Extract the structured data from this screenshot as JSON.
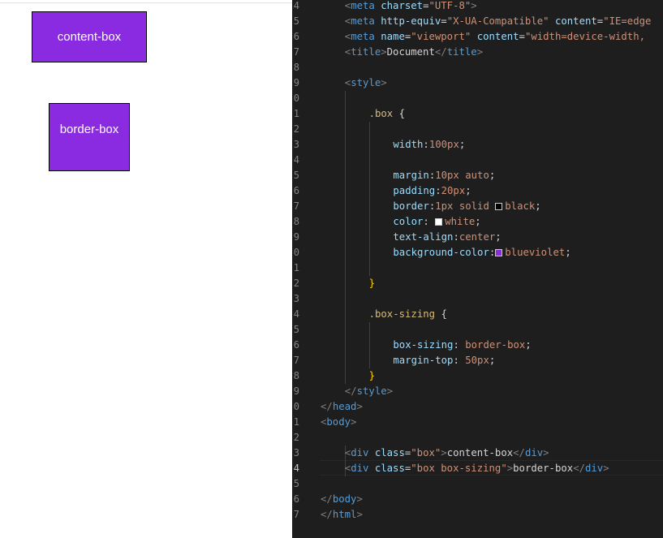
{
  "preview": {
    "boxes": [
      {
        "label": "content-box"
      },
      {
        "label": "border-box"
      }
    ],
    "box_bg": "#8a2be2"
  },
  "editor": {
    "active_line": "4",
    "lines": [
      {
        "num": "4",
        "tokens": [
          [
            "t-pun",
            "<"
          ],
          [
            "t-tag",
            "meta "
          ],
          [
            "t-attr",
            "charset"
          ],
          [
            "t-txt",
            "="
          ],
          [
            "t-str",
            "\"UTF-8\""
          ],
          [
            "t-pun",
            ">"
          ]
        ]
      },
      {
        "num": "5",
        "tokens": [
          [
            "t-pun",
            "<"
          ],
          [
            "t-tag",
            "meta "
          ],
          [
            "t-attr",
            "http-equiv"
          ],
          [
            "t-txt",
            "="
          ],
          [
            "t-str",
            "\"X-UA-Compatible\" "
          ],
          [
            "t-attr",
            "content"
          ],
          [
            "t-txt",
            "="
          ],
          [
            "t-str",
            "\"IE=edge"
          ]
        ]
      },
      {
        "num": "6",
        "tokens": [
          [
            "t-pun",
            "<"
          ],
          [
            "t-tag",
            "meta "
          ],
          [
            "t-attr",
            "name"
          ],
          [
            "t-txt",
            "="
          ],
          [
            "t-str",
            "\"viewport\" "
          ],
          [
            "t-attr",
            "content"
          ],
          [
            "t-txt",
            "="
          ],
          [
            "t-str",
            "\"width=device-width,"
          ]
        ]
      },
      {
        "num": "7",
        "tokens": [
          [
            "t-pun",
            "<"
          ],
          [
            "t-tag",
            "title"
          ],
          [
            "t-pun",
            ">"
          ],
          [
            "t-txt",
            "Document"
          ],
          [
            "t-pun",
            "</"
          ],
          [
            "t-tag",
            "title"
          ],
          [
            "t-pun",
            ">"
          ]
        ]
      },
      {
        "num": "8",
        "tokens": []
      },
      {
        "num": "9",
        "tokens": [
          [
            "t-pun",
            "<"
          ],
          [
            "t-tag",
            "style"
          ],
          [
            "t-pun",
            ">"
          ]
        ]
      },
      {
        "num": "0",
        "tokens": []
      },
      {
        "num": "1",
        "tokens": [
          [
            "t-sel",
            ".box "
          ],
          [
            "t-txt",
            "{"
          ]
        ]
      },
      {
        "num": "2",
        "tokens": []
      },
      {
        "num": "3",
        "tokens": [
          [
            "t-prop",
            "width"
          ],
          [
            "t-txt",
            ":"
          ],
          [
            "t-val",
            "100px"
          ],
          [
            "t-txt",
            ";"
          ]
        ]
      },
      {
        "num": "4",
        "tokens": []
      },
      {
        "num": "5",
        "tokens": [
          [
            "t-prop",
            "margin"
          ],
          [
            "t-txt",
            ":"
          ],
          [
            "t-val",
            "10px auto"
          ],
          [
            "t-txt",
            ";"
          ]
        ]
      },
      {
        "num": "6",
        "tokens": [
          [
            "t-prop",
            "padding"
          ],
          [
            "t-txt",
            ":"
          ],
          [
            "t-val",
            "20px"
          ],
          [
            "t-txt",
            ";"
          ]
        ]
      },
      {
        "num": "7",
        "tokens": [
          [
            "t-prop",
            "border"
          ],
          [
            "t-txt",
            ":"
          ],
          [
            "t-val",
            "1px solid "
          ],
          [
            "swatch",
            "#000000"
          ],
          [
            "t-val",
            "black"
          ],
          [
            "t-txt",
            ";"
          ]
        ]
      },
      {
        "num": "8",
        "tokens": [
          [
            "t-prop",
            "color"
          ],
          [
            "t-txt",
            ": "
          ],
          [
            "swatch",
            "#ffffff"
          ],
          [
            "t-val",
            "white"
          ],
          [
            "t-txt",
            ";"
          ]
        ]
      },
      {
        "num": "9",
        "tokens": [
          [
            "t-prop",
            "text-align"
          ],
          [
            "t-txt",
            ":"
          ],
          [
            "t-val",
            "center"
          ],
          [
            "t-txt",
            ";"
          ]
        ]
      },
      {
        "num": "0",
        "tokens": [
          [
            "t-prop",
            "background-color"
          ],
          [
            "t-txt",
            ":"
          ],
          [
            "swatch",
            "#8a2be2"
          ],
          [
            "t-val",
            "blueviolet"
          ],
          [
            "t-txt",
            ";"
          ]
        ]
      },
      {
        "num": "1",
        "tokens": []
      },
      {
        "num": "2",
        "tokens": [
          [
            "t-brace",
            "}"
          ]
        ]
      },
      {
        "num": "3",
        "tokens": []
      },
      {
        "num": "4",
        "tokens": [
          [
            "t-sel",
            ".box-sizing "
          ],
          [
            "t-txt",
            "{"
          ]
        ]
      },
      {
        "num": "5",
        "tokens": []
      },
      {
        "num": "6",
        "tokens": [
          [
            "t-prop",
            "box-sizing"
          ],
          [
            "t-txt",
            ": "
          ],
          [
            "t-val",
            "border-box"
          ],
          [
            "t-txt",
            ";"
          ]
        ]
      },
      {
        "num": "7",
        "tokens": [
          [
            "t-prop",
            "margin-top"
          ],
          [
            "t-txt",
            ": "
          ],
          [
            "t-val",
            "50px"
          ],
          [
            "t-txt",
            ";"
          ]
        ]
      },
      {
        "num": "8",
        "tokens": [
          [
            "t-brace",
            "}"
          ]
        ]
      },
      {
        "num": "9",
        "tokens": [
          [
            "t-pun",
            "</"
          ],
          [
            "t-tag",
            "style"
          ],
          [
            "t-pun",
            ">"
          ]
        ]
      },
      {
        "num": "0",
        "tokens": [
          [
            "t-pun",
            "</"
          ],
          [
            "t-tag",
            "head"
          ],
          [
            "t-pun",
            ">"
          ]
        ]
      },
      {
        "num": "1",
        "tokens": [
          [
            "t-pun",
            "<"
          ],
          [
            "t-tag",
            "body"
          ],
          [
            "t-pun",
            ">"
          ]
        ]
      },
      {
        "num": "2",
        "tokens": []
      },
      {
        "num": "3",
        "tokens": [
          [
            "t-pun",
            "<"
          ],
          [
            "t-tag",
            "div "
          ],
          [
            "t-attr",
            "class"
          ],
          [
            "t-txt",
            "="
          ],
          [
            "t-str",
            "\"box\""
          ],
          [
            "t-pun",
            ">"
          ],
          [
            "t-txt",
            "content-box"
          ],
          [
            "t-pun",
            "</"
          ],
          [
            "t-tag",
            "div"
          ],
          [
            "t-pun",
            ">"
          ]
        ]
      },
      {
        "num": "4",
        "tokens": [
          [
            "t-pun",
            "<"
          ],
          [
            "t-tag",
            "div "
          ],
          [
            "t-attr",
            "class"
          ],
          [
            "t-txt",
            "="
          ],
          [
            "t-str",
            "\"box box-sizing\""
          ],
          [
            "t-pun",
            ">"
          ],
          [
            "t-txt",
            "border-box"
          ],
          [
            "t-pun",
            "</"
          ],
          [
            "t-tag",
            "div"
          ],
          [
            "t-pun",
            ">"
          ]
        ]
      },
      {
        "num": "5",
        "tokens": []
      },
      {
        "num": "6",
        "tokens": [
          [
            "t-pun",
            "</"
          ],
          [
            "t-tag",
            "body"
          ],
          [
            "t-pun",
            ">"
          ]
        ]
      },
      {
        "num": "7",
        "tokens": [
          [
            "t-pun",
            "</"
          ],
          [
            "t-tag",
            "html"
          ],
          [
            "t-pun",
            ">"
          ]
        ]
      }
    ]
  }
}
